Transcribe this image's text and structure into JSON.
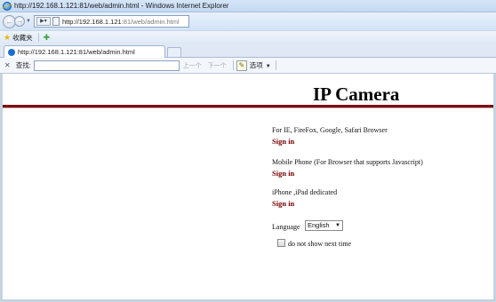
{
  "window": {
    "title": "http://192.168.1.121:81/web/admin.html - Windows Internet Explorer"
  },
  "address_bar": {
    "url_host": "http://192.168.1.121",
    "url_rest": ":81/web/admin.html"
  },
  "favorites_bar": {
    "favorites_label": "收藏夹"
  },
  "tab": {
    "label": "http://192.168.1.121:81/web/admin.html"
  },
  "find_bar": {
    "label": "查找:",
    "query": "",
    "prev_label": "上一个",
    "next_label": "下一个",
    "options_label": "选项"
  },
  "page": {
    "title": "IP Camera",
    "options": [
      {
        "description": "For IE, FireFox, Google, Safari Browser",
        "link": "Sign in"
      },
      {
        "description": "Mobile Phone (For Browser that supports Javascript)",
        "link": "Sign in"
      },
      {
        "description": "iPhone ,iPad dedicated",
        "link": "Sign in"
      }
    ],
    "language_label": "Language",
    "language_selected": "English",
    "dont_show_label": "do not show next time",
    "dont_show_checked": false
  }
}
